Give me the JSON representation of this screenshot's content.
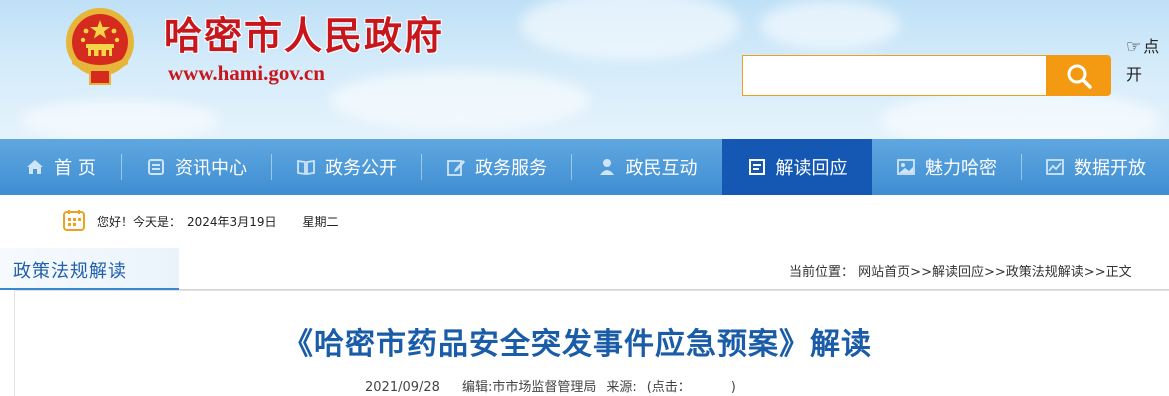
{
  "header": {
    "site_title": "哈密市人民政府",
    "site_url": "www.hami.gov.cn",
    "search": {
      "value": "",
      "placeholder": ""
    },
    "side_link_line1": "点",
    "side_link_line2": "开",
    "colors": {
      "title_red": "#c8161d",
      "search_orange": "#f39a12"
    },
    "icons": {
      "emblem": "national-emblem-icon",
      "search": "search-icon",
      "hand": "hand-pointer-icon"
    }
  },
  "nav": {
    "active_color": "#1458b4",
    "items": [
      {
        "label": "首 页",
        "icon": "home-icon",
        "active": false
      },
      {
        "label": "资讯中心",
        "icon": "news-icon",
        "active": false
      },
      {
        "label": "政务公开",
        "icon": "book-icon",
        "active": false
      },
      {
        "label": "政务服务",
        "icon": "edit-icon",
        "active": false
      },
      {
        "label": "政民互动",
        "icon": "user-icon",
        "active": false
      },
      {
        "label": "解读回应",
        "icon": "document-icon",
        "active": true
      },
      {
        "label": "魅力哈密",
        "icon": "image-icon",
        "active": false
      },
      {
        "label": "数据开放",
        "icon": "chart-icon",
        "active": false
      }
    ]
  },
  "datebar": {
    "greeting": "您好！今天是：",
    "date": "2024年3月19日",
    "weekday": "星期二",
    "icon": "calendar-icon"
  },
  "section": {
    "title": "政策法规解读",
    "breadcrumb": {
      "prefix": "当前位置：",
      "items": [
        "网站首页",
        "解读回应",
        "政策法规解读",
        "正文"
      ],
      "separator": ">>"
    }
  },
  "article": {
    "title": "《哈密市药品安全突发事件应急预案》解读",
    "date": "2021/09/28",
    "editor": "编辑:市市场监督管理局",
    "source": "来源:",
    "hits_open": "(点击：",
    "hits_close": ")"
  }
}
